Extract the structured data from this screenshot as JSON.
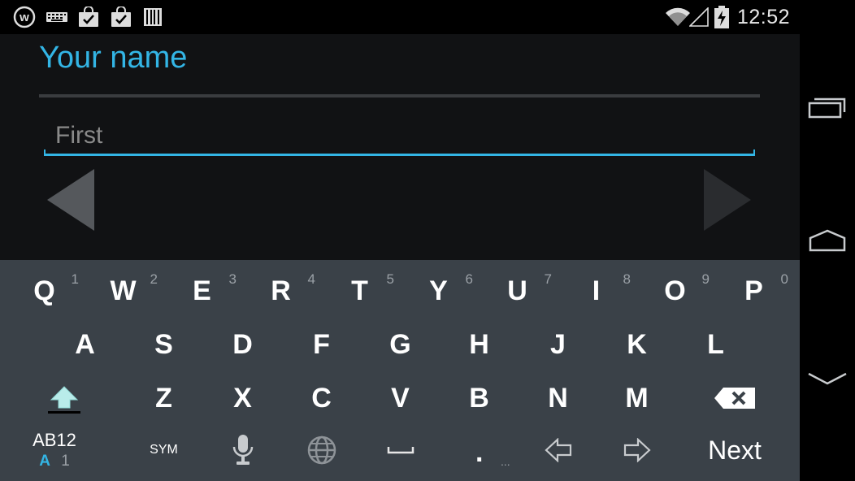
{
  "status_bar": {
    "time": "12:52",
    "left_icons": [
      "wordweb-icon",
      "keyboard-icon",
      "shopping-bag-check-icon",
      "shopping-bag-check-icon",
      "barcode-icon"
    ],
    "right_icons": [
      "wifi-icon",
      "cell-signal-icon",
      "battery-charging-icon"
    ]
  },
  "form": {
    "title": "Your name",
    "first_name_value": "",
    "first_name_placeholder": "First",
    "accent_color": "#33b5e5"
  },
  "keyboard": {
    "row1": [
      {
        "label": "Q",
        "hint": "1"
      },
      {
        "label": "W",
        "hint": "2"
      },
      {
        "label": "E",
        "hint": "3"
      },
      {
        "label": "R",
        "hint": "4"
      },
      {
        "label": "T",
        "hint": "5"
      },
      {
        "label": "Y",
        "hint": "6"
      },
      {
        "label": "U",
        "hint": "7"
      },
      {
        "label": "I",
        "hint": "8"
      },
      {
        "label": "O",
        "hint": "9"
      },
      {
        "label": "P",
        "hint": "0"
      }
    ],
    "row2": [
      "A",
      "S",
      "D",
      "F",
      "G",
      "H",
      "J",
      "K",
      "L"
    ],
    "row3": [
      "Z",
      "X",
      "C",
      "V",
      "B",
      "N",
      "M"
    ],
    "mode_label": "AB12",
    "mode_sub_a": "A",
    "mode_sub_1": "1",
    "sym_label": "SYM",
    "period_label": ".",
    "period_sub": "...",
    "next_label": "Next"
  },
  "navbar": {
    "buttons": [
      "recents-icon",
      "home-icon",
      "back-icon"
    ]
  }
}
